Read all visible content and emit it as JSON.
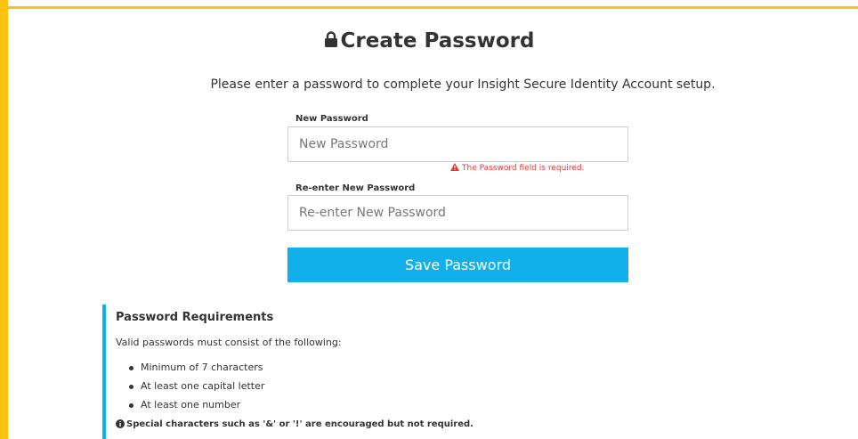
{
  "page": {
    "title": "Create Password",
    "subtitle": "Please enter a password to complete your Insight Secure Identity Account setup.",
    "accent_color": "#12b0ea",
    "frame_color": "#ffc20e",
    "error_color": "#e53935"
  },
  "form": {
    "new_password": {
      "label": "New Password",
      "placeholder": "New Password",
      "value": "",
      "error": "The Password field is required."
    },
    "confirm_password": {
      "label": "Re-enter New Password",
      "placeholder": "Re-enter New Password",
      "value": ""
    },
    "save_label": "Save Password"
  },
  "requirements": {
    "title": "Password Requirements",
    "description": "Valid passwords must consist of the following:",
    "items": [
      "Minimum of 7 characters",
      "At least one capital letter",
      "At least one number"
    ],
    "note": "Special characters such as '&' or '!' are encouraged but not required."
  },
  "icons": {
    "title": "lock-icon",
    "error": "warning-icon",
    "note": "info-icon"
  }
}
